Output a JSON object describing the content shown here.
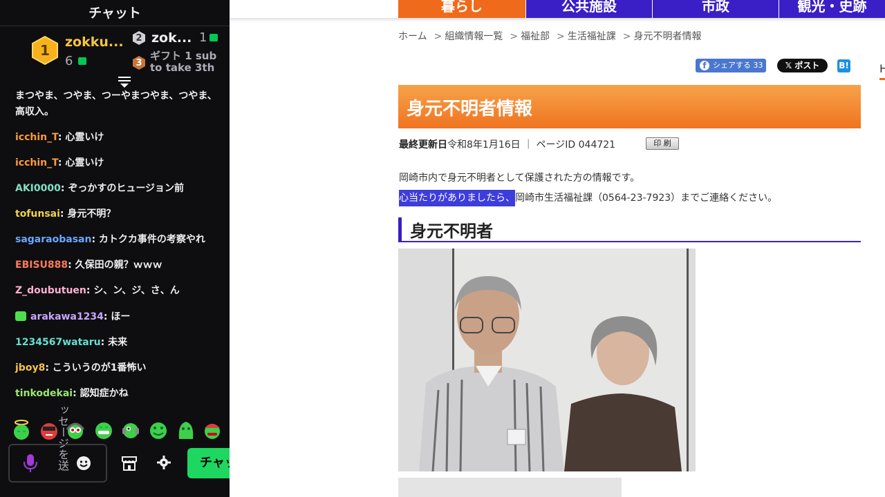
{
  "chat": {
    "title": "チャット",
    "leaderboard": {
      "first": {
        "rank": "1",
        "name": "zokku...",
        "count": "6"
      },
      "second": {
        "rank": "2",
        "name": "zok...",
        "count": "1"
      },
      "third": {
        "rank": "3",
        "text": "ギフト 1 sub to take 3th"
      }
    },
    "messages": [
      {
        "user": "",
        "text": "まつやま、つやま、つーやまつやま、つやま、高収入。",
        "color": "#efeff1"
      },
      {
        "user": "icchin_T",
        "text": ": 心霊いけ",
        "color": "#ff9a3c"
      },
      {
        "user": "icchin_T",
        "text": ": 心霊いけ",
        "color": "#ff9a3c"
      },
      {
        "user": "AKI0000",
        "text": ": ぞっかすのヒュージョン前",
        "color": "#7fe0c6"
      },
      {
        "user": "tofunsai",
        "text": ": 身元不明？",
        "color": "#f2d34b"
      },
      {
        "user": "sagaraobasan",
        "text": ": カトクカ事件の考察やれ",
        "color": "#6aa7ff"
      },
      {
        "user": "EBISU888",
        "text": ": 久保田の親？ｗｗｗ",
        "color": "#ff7a5c"
      },
      {
        "user": "Z_doubutuen",
        "text": ": シ、ン、ジ、さ、ん",
        "color": "#ffb0d0"
      },
      {
        "user": "arakawa1234",
        "text": ": ほー",
        "color": "#c9a6ff"
      },
      {
        "user": "1234567wataru",
        "text": ": 未来",
        "color": "#66e0d0"
      },
      {
        "user": "jboy8",
        "text": ": こういうのが1番怖い",
        "color": "#f5c542"
      },
      {
        "user": "tinkodekai",
        "text": ": 認知症かね",
        "color": "#9be86c"
      }
    ],
    "input_vertical_text": "ッセージを送",
    "send_label": "チャット"
  },
  "nav": {
    "items": [
      "暮らし",
      "公共施設",
      "市政",
      "観光・史跡"
    ]
  },
  "breadcrumb": [
    "ホーム",
    "組織情報一覧",
    "福祉部",
    "生活福祉課",
    "身元不明者情報"
  ],
  "share": {
    "facebook": "シェアする 33",
    "x": "ポスト",
    "hatena": "B!"
  },
  "edge_letter": "H",
  "page": {
    "title": "身元不明者情報",
    "updated_label": "最終更新日",
    "updated_date": "令和8年1月16日",
    "page_id_label": "ページID",
    "page_id": "044721",
    "print_label": "印 刷",
    "intro": "岡崎市内で身元不明者として保護された方の情報です。",
    "contact_highlight": "心当たりがありましたら、",
    "contact_rest": "岡崎市生活福祉課（0564-23-7923）までご連絡ください。",
    "section_heading": "身元不明者"
  }
}
